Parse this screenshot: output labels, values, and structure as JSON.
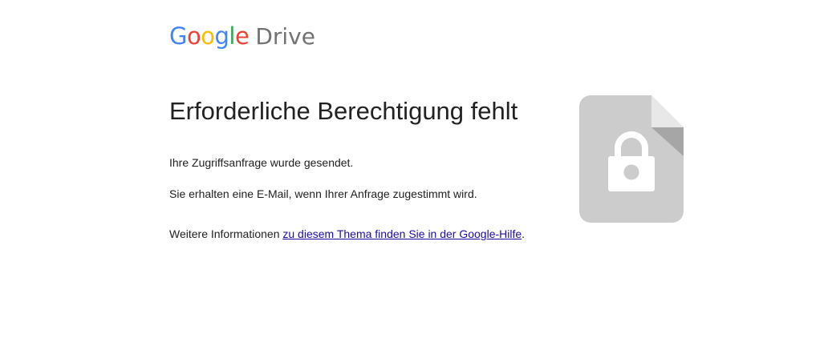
{
  "header": {
    "logo_letters": [
      {
        "char": "G",
        "color": "#4285F4"
      },
      {
        "char": "o",
        "color": "#EA4335"
      },
      {
        "char": "o",
        "color": "#FBBC05"
      },
      {
        "char": "g",
        "color": "#4285F4"
      },
      {
        "char": "l",
        "color": "#34A853"
      },
      {
        "char": "e",
        "color": "#EA4335"
      }
    ],
    "product_name": "Drive",
    "product_color": "#737373"
  },
  "main": {
    "title": "Erforderliche Berechtigung fehlt",
    "request_sent": "Ihre Zugriffsanfrage wurde gesendet.",
    "email_notice": "Sie erhalten eine E-Mail, wenn Ihrer Anfrage zugestimmt wird.",
    "more_info_prefix": "Weitere Informationen ",
    "help_link_label": "zu diesem Thema finden Sie in der Google-Hilfe",
    "more_info_suffix": "."
  },
  "illustration": {
    "icon": "locked-file-icon",
    "file_color": "#CCCCCC",
    "fold_color": "#E8E8E8",
    "fold_shadow_color": "#A6A6A6",
    "lock_color": "#FFFFFF"
  }
}
